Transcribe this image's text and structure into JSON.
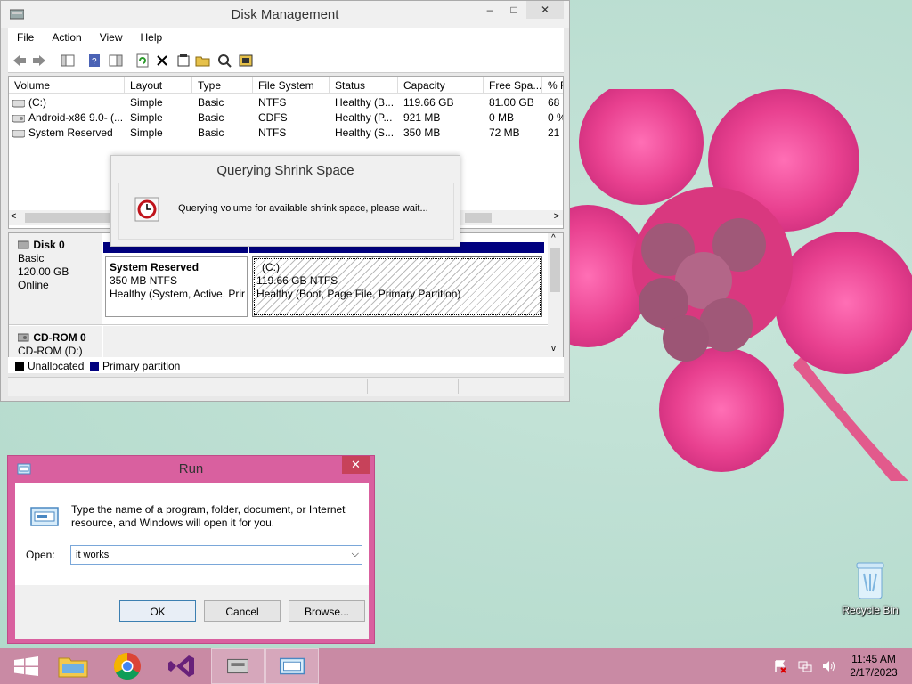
{
  "disk_management": {
    "title": "Disk Management",
    "window_controls": {
      "minimize": "–",
      "maximize": "□",
      "close": "✕"
    },
    "menu": [
      "File",
      "Action",
      "View",
      "Help"
    ],
    "volume_columns": [
      "Volume",
      "Layout",
      "Type",
      "File System",
      "Status",
      "Capacity",
      "Free Spa...",
      "% F"
    ],
    "volumes": [
      [
        "(C:)",
        "Simple",
        "Basic",
        "NTFS",
        "Healthy (B...",
        "119.66 GB",
        "81.00 GB",
        "68"
      ],
      [
        "Android-x86 9.0- (...",
        "Simple",
        "Basic",
        "CDFS",
        "Healthy (P...",
        "921 MB",
        "0 MB",
        "0 %"
      ],
      [
        "System Reserved",
        "Simple",
        "Basic",
        "NTFS",
        "Healthy (S...",
        "350 MB",
        "72 MB",
        "21"
      ]
    ],
    "disk0": {
      "name": "Disk 0",
      "type": "Basic",
      "size": "120.00 GB",
      "state": "Online",
      "partitions": [
        {
          "name": "System Reserved",
          "size": "350 MB NTFS",
          "status": "Healthy (System, Active, Prir"
        },
        {
          "name": "(C:)",
          "size": "119.66 GB NTFS",
          "status": "Healthy (Boot, Page File, Primary Partition)"
        }
      ]
    },
    "cdrom0": {
      "name": "CD-ROM 0",
      "sub": "CD-ROM (D:)"
    },
    "legend": {
      "unallocated": "Unallocated",
      "primary": "Primary partition"
    },
    "colors": {
      "unallocated": "#000000",
      "primary": "#00007f"
    }
  },
  "query_dialog": {
    "title": "Querying Shrink Space",
    "message": "Querying volume for available shrink space, please wait..."
  },
  "run_dialog": {
    "title": "Run",
    "close": "✕",
    "message": "Type the name of a program, folder, document, or Internet resource, and Windows will open it for you.",
    "open_label": "Open:",
    "open_value": "it works",
    "ok": "OK",
    "cancel": "Cancel",
    "browse": "Browse..."
  },
  "desktop": {
    "recycle_bin": "Recycle Bin"
  },
  "taskbar": {
    "time": "11:45 AM",
    "date": "2/17/2023"
  }
}
